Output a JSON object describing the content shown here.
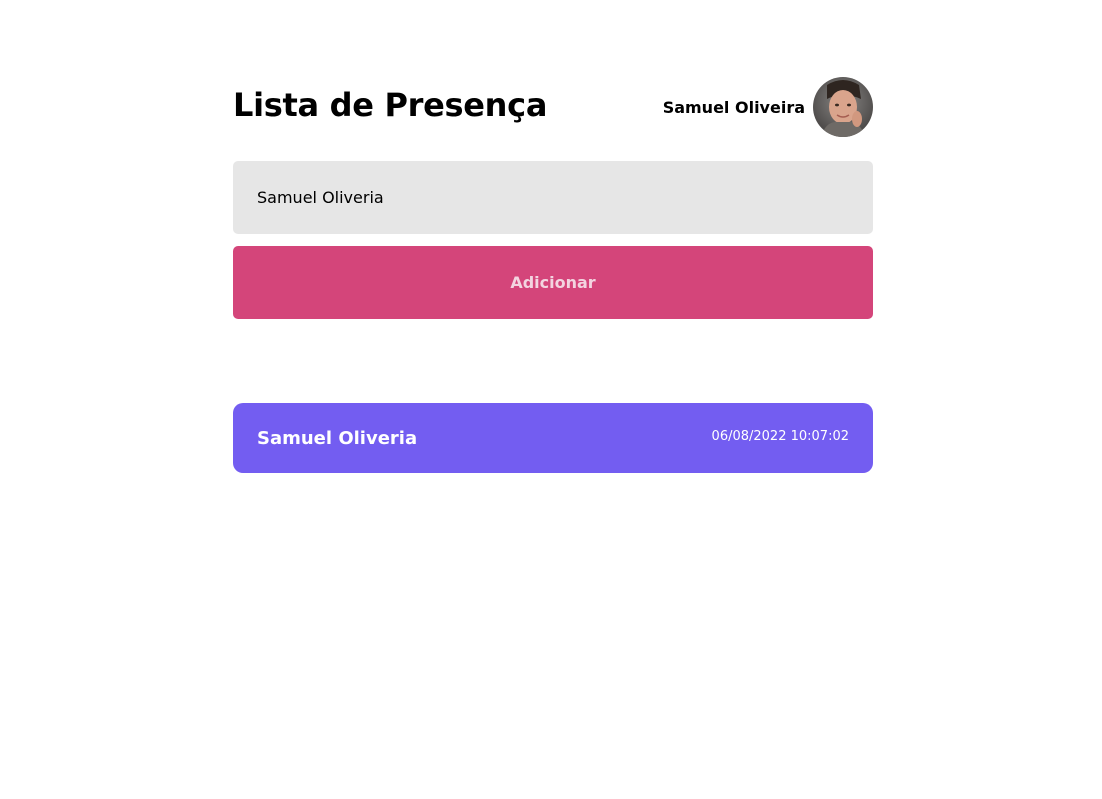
{
  "header": {
    "title": "Lista de Presença",
    "user_name": "Samuel Oliveira",
    "avatar_icon": "user-avatar-photo"
  },
  "form": {
    "input_value": "Samuel Oliveria",
    "input_placeholder": "",
    "add_label": "Adicionar"
  },
  "attendees": [
    {
      "name": "Samuel Oliveria",
      "time": "06/08/2022 10:07:02"
    }
  ],
  "colors": {
    "accent_pink": "#d4457a",
    "card_purple": "#735df1",
    "input_bg": "#e6e6e6"
  }
}
